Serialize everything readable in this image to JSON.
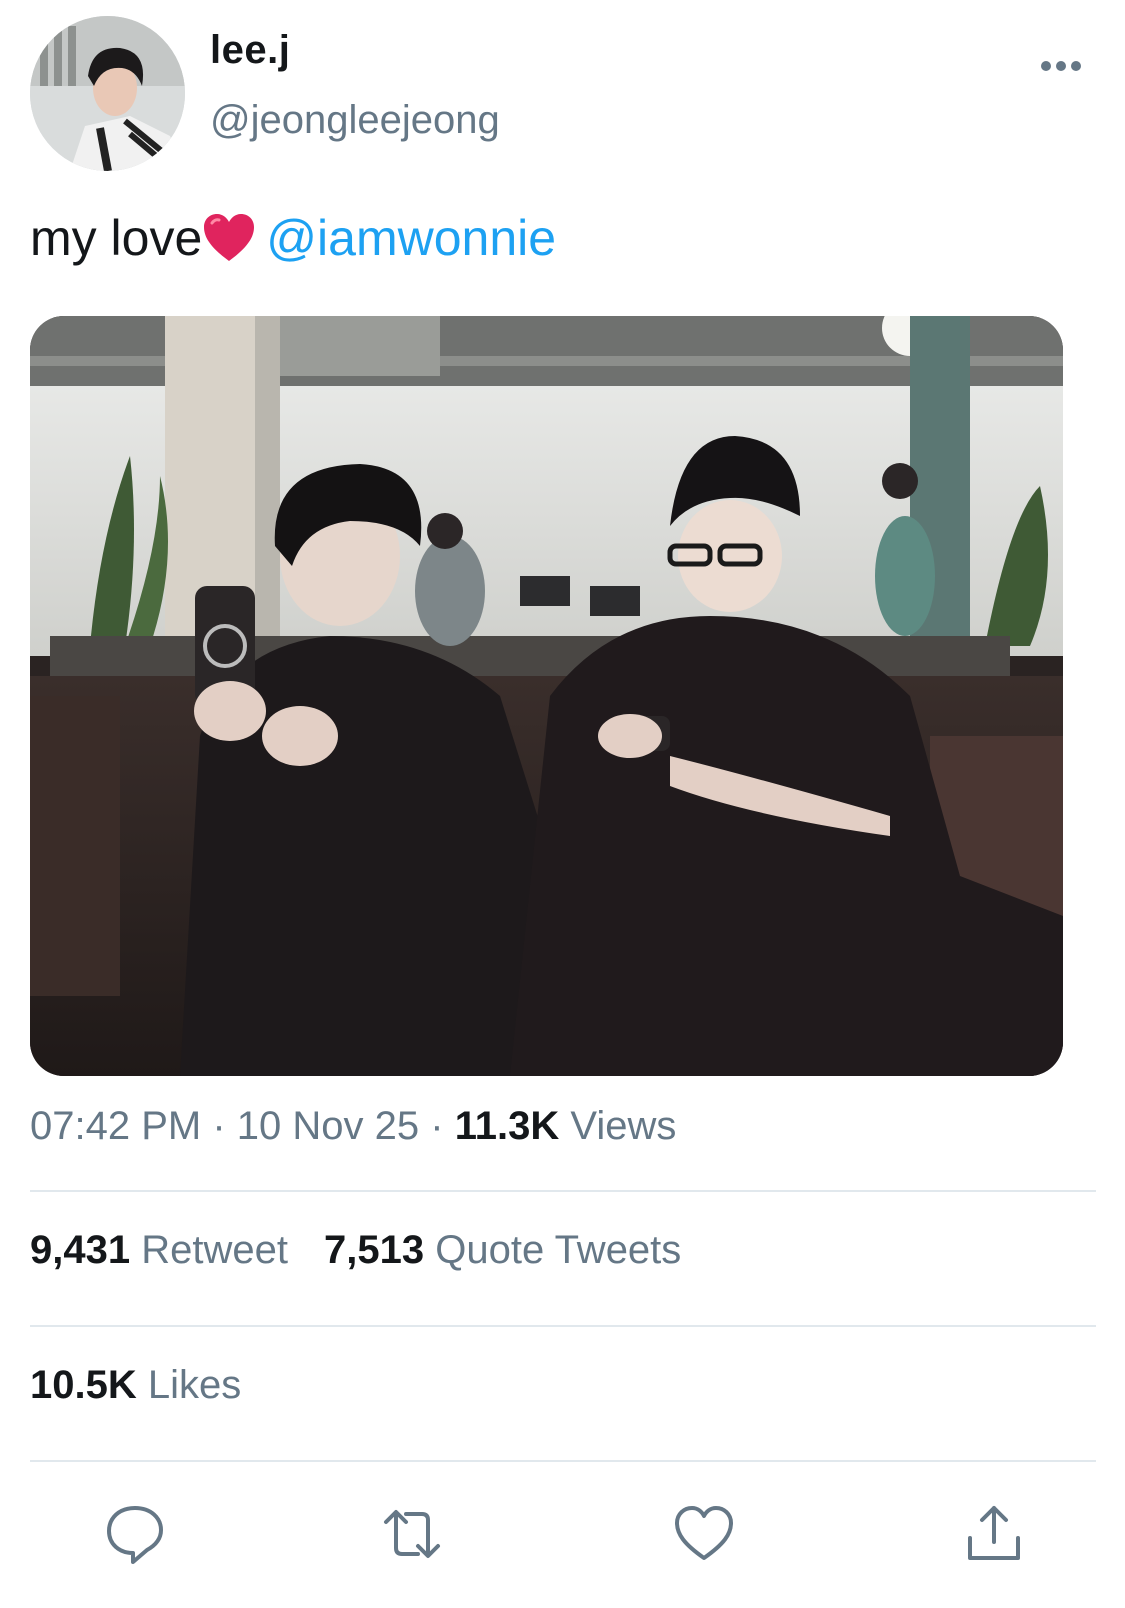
{
  "author": {
    "display_name": "lee.j",
    "handle": "@jeongleejeong"
  },
  "tweet": {
    "text": "my love",
    "emoji": "heart-emoji",
    "mention": "@iamwonnie"
  },
  "meta": {
    "time": "07:42 PM",
    "separator": "·",
    "date": "10 Nov 25",
    "views_count": "11.3K",
    "views_label": "Views"
  },
  "stats": {
    "retweets_count": "9,431",
    "retweets_label": "Retweet",
    "quotes_count": "7,513",
    "quotes_label": "Quote Tweets",
    "likes_count": "10.5K",
    "likes_label": "Likes"
  },
  "actions": [
    "reply-icon",
    "retweet-icon",
    "like-icon",
    "share-icon"
  ],
  "colors": {
    "text": "#14171a",
    "secondary": "#657786",
    "link": "#1da1f2",
    "divider": "#e1e8ed",
    "heart": "#e0245e"
  }
}
